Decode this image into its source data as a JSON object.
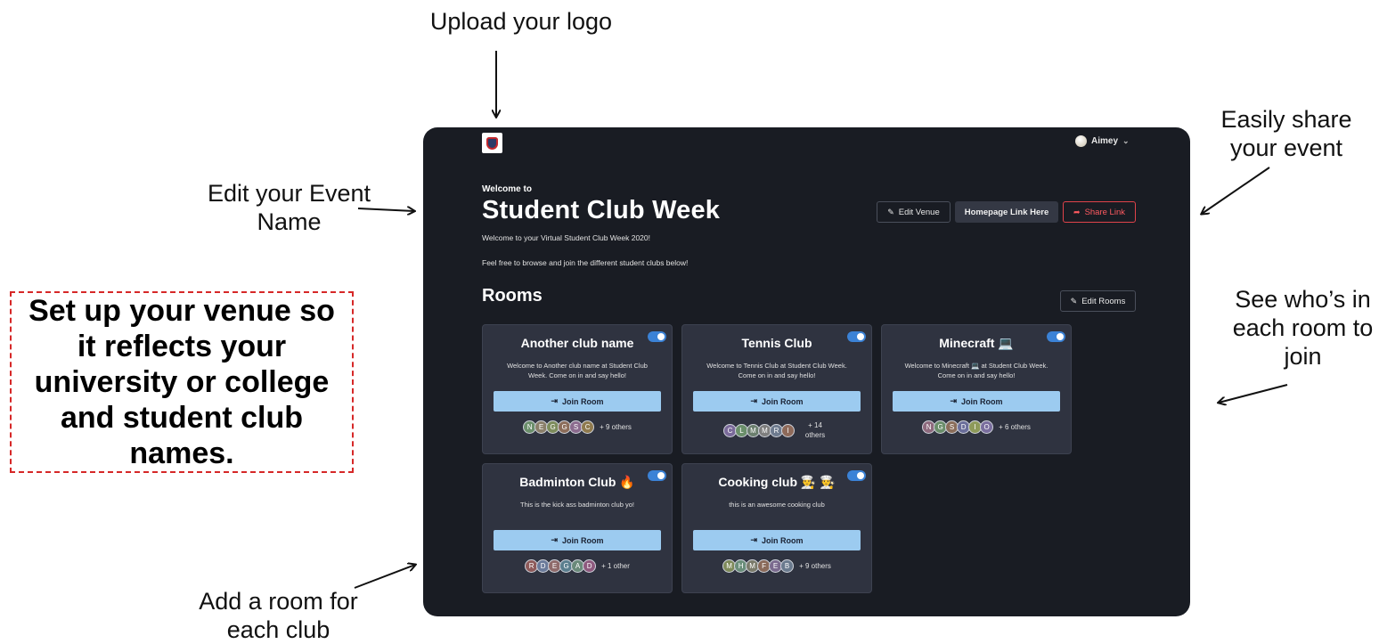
{
  "annotations": {
    "upload_logo": "Upload your logo",
    "edit_event_name": "Edit your Event Name",
    "share_event": "Easily share your event",
    "see_whos_in": "See who’s in each room to join",
    "add_room": "Add a room for each club",
    "callout": "Set up your venue so it reflects your university or college and student club names."
  },
  "header": {
    "user_name": "Aimey",
    "user_avatar_icon": "avatar",
    "chevron_icon": "chevron-down-icon",
    "logo_icon": "shield-logo-icon"
  },
  "event": {
    "welcome_label": "Welcome to",
    "title": "Student Club Week",
    "description_line1": "Welcome to your Virtual Student Club Week 2020!",
    "description_line2": "Feel free to browse and join the different student clubs below!"
  },
  "actions": {
    "edit_venue": "Edit Venue",
    "homepage_link": "Homepage Link Here",
    "share_link": "Share Link",
    "edit_rooms": "Edit Rooms"
  },
  "rooms_heading": "Rooms",
  "join_label": "Join Room",
  "rooms": [
    {
      "title": "Another club name",
      "description": "Welcome to Another club name at Student Club Week. Come on in and say hello!",
      "enabled": true,
      "participants": [
        "N",
        "E",
        "G",
        "G",
        "S",
        "C"
      ],
      "others": "+ 9 others"
    },
    {
      "title": "Tennis Club",
      "description": "Welcome to Tennis Club at Student Club Week. Come on in and say hello!",
      "enabled": true,
      "participants": [
        "C",
        "L",
        "M",
        "M",
        "R",
        "I"
      ],
      "others": "+ 14 others"
    },
    {
      "title": "Minecraft 💻",
      "description": "Welcome to Minecraft 💻 at Student Club Week. Come on in and say hello!",
      "enabled": true,
      "participants": [
        "N",
        "G",
        "S",
        "D",
        "I",
        "O"
      ],
      "others": "+ 6 others"
    },
    {
      "title": "Badminton Club 🔥",
      "description": "This is the kick ass badminton club yo!",
      "enabled": true,
      "participants": [
        "R",
        "D",
        "E",
        "G",
        "A",
        "D"
      ],
      "others": "+ 1 other"
    },
    {
      "title": "Cooking club 👨‍🍳 👨‍🍳",
      "description": "this is an awesome cooking club",
      "enabled": true,
      "participants": [
        "M",
        "H",
        "M",
        "F",
        "E",
        "B"
      ],
      "others": "+ 9 others"
    }
  ],
  "colors": {
    "app_background": "#191c23",
    "card_background": "#2f3340",
    "join_button": "#9ccbf0",
    "toggle_on": "#3b82d6",
    "share_accent": "#e0434a",
    "callout_border": "#d62828"
  }
}
